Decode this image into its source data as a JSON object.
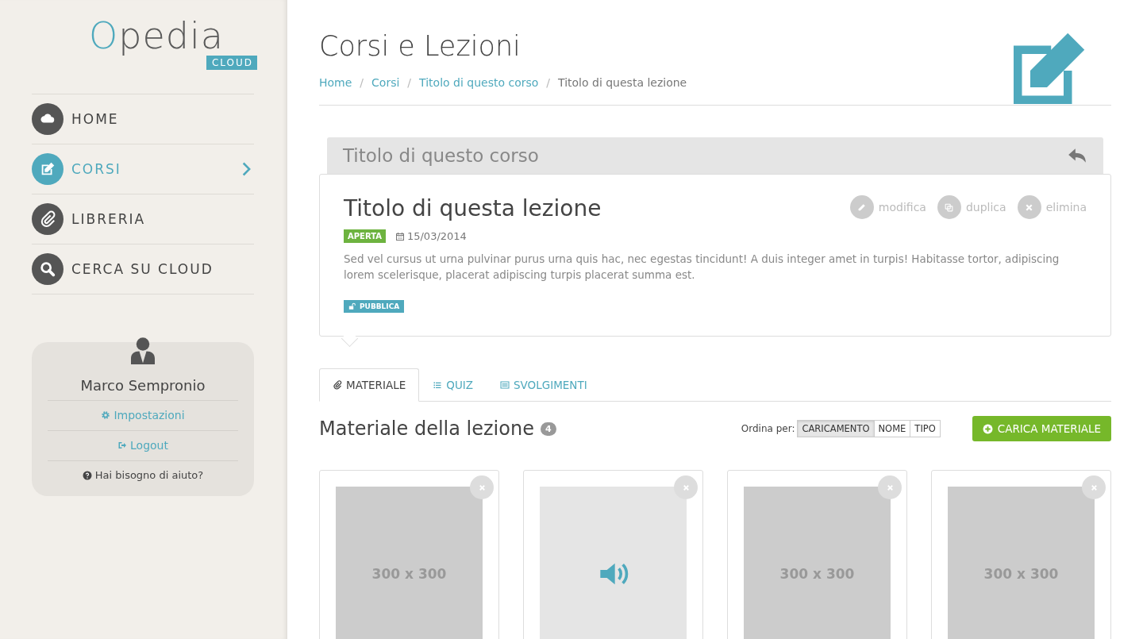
{
  "sidebar": {
    "logo": {
      "first": "O",
      "rest": "pedia",
      "badge": "CLOUD"
    },
    "nav": [
      {
        "label": "HOME",
        "selected": false
      },
      {
        "label": "CORSI",
        "selected": true
      },
      {
        "label": "LIBRERIA",
        "selected": false
      },
      {
        "label": "CERCA SU CLOUD",
        "selected": false
      }
    ],
    "user": {
      "name": "Marco Sempronio",
      "links": [
        {
          "label": "Impostazioni",
          "kind": "link"
        },
        {
          "label": "Logout",
          "kind": "link"
        },
        {
          "label": "Hai bisogno di aiuto?",
          "kind": "help"
        }
      ]
    }
  },
  "page": {
    "title": "Corsi e Lezioni",
    "breadcrumb": [
      {
        "label": "Home",
        "current": false
      },
      {
        "separator": "/",
        "label": "Corsi",
        "current": false
      },
      {
        "separator": "/",
        "label": "Titolo di questo corso",
        "current": false
      },
      {
        "separator": "/",
        "label": "Titolo di questa lezione",
        "current": true
      }
    ]
  },
  "course": {
    "title": "Titolo di questo corso"
  },
  "lesson": {
    "title": "Titolo di questa lezione",
    "status": "APERTA",
    "date": "15/03/2014",
    "description": "Sed vel cursus ut urna pulvinar purus urna quis hac, nec egestas tincidunt! A duis integer amet in turpis! Habitasse tortor, adipiscing lorem scelerisque, placerat adipiscing turpis placerat summa est.",
    "visibility": "PUBBLICA",
    "actions": [
      {
        "label": "modifica"
      },
      {
        "label": "duplica"
      },
      {
        "label": "elimina"
      }
    ]
  },
  "tabs": [
    {
      "label": "MATERIALE",
      "selected": true
    },
    {
      "label": "QUIZ",
      "selected": false
    },
    {
      "label": "SVOLGIMENTI",
      "selected": false
    }
  ],
  "materials": {
    "title": "Materiale della lezione",
    "count": "4",
    "sort_label": "Ordina per:",
    "sort_options": [
      {
        "label": "CARICAMENTO",
        "selected": true
      },
      {
        "label": "NOME",
        "selected": false
      },
      {
        "label": "TIPO",
        "selected": false
      }
    ],
    "upload_button": "CARICA MATERIALE",
    "items": [
      {
        "kind": "image",
        "placeholder": "300 x 300"
      },
      {
        "kind": "audio"
      },
      {
        "kind": "image",
        "placeholder": "300 x 300"
      },
      {
        "kind": "image",
        "placeholder": "300 x 300"
      }
    ]
  }
}
